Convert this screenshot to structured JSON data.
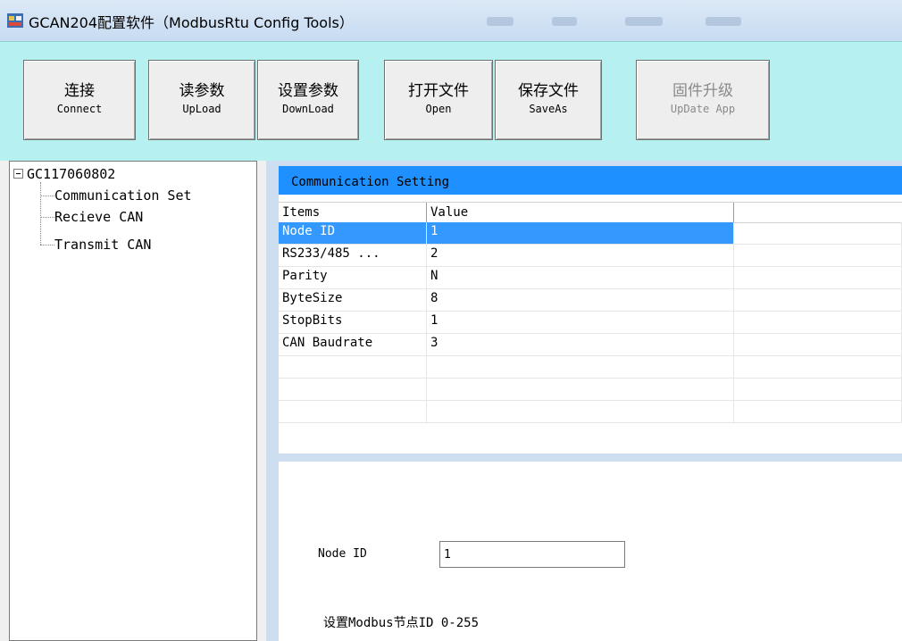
{
  "window": {
    "title": "GCAN204配置软件（ModbusRtu Config Tools）"
  },
  "toolbar": {
    "buttons": [
      {
        "cn": "连接",
        "en": "Connect",
        "enabled": true
      },
      {
        "cn": "读参数",
        "en": "UpLoad",
        "enabled": true
      },
      {
        "cn": "设置参数",
        "en": "DownLoad",
        "enabled": true
      },
      {
        "cn": "打开文件",
        "en": "Open",
        "enabled": true
      },
      {
        "cn": "保存文件",
        "en": "SaveAs",
        "enabled": true
      },
      {
        "cn": "固件升级",
        "en": "UpDate App",
        "enabled": false
      }
    ]
  },
  "tree": {
    "root": "GC117060802",
    "items": [
      "Communication Set",
      "Recieve CAN",
      "Transmit CAN"
    ]
  },
  "panel": {
    "title": "Communication Setting",
    "columns": [
      "Items",
      "Value",
      ""
    ],
    "rows": [
      {
        "item": "Node ID",
        "value": "1",
        "selected": true
      },
      {
        "item": "RS233/485 ...",
        "value": "2"
      },
      {
        "item": "Parity",
        "value": "N"
      },
      {
        "item": "ByteSize",
        "value": "8"
      },
      {
        "item": "StopBits",
        "value": "1"
      },
      {
        "item": "CAN Baudrate",
        "value": "3"
      },
      {
        "item": "",
        "value": ""
      },
      {
        "item": "",
        "value": ""
      },
      {
        "item": "",
        "value": ""
      }
    ]
  },
  "editor": {
    "label": "Node ID",
    "value": "1",
    "hint": "设置Modbus节点ID 0-255"
  },
  "colors": {
    "toolbar_bg": "#b6f0f0",
    "panel_header": "#1e90ff",
    "selection": "#3399ff",
    "panel_bg": "#ccdef0"
  }
}
